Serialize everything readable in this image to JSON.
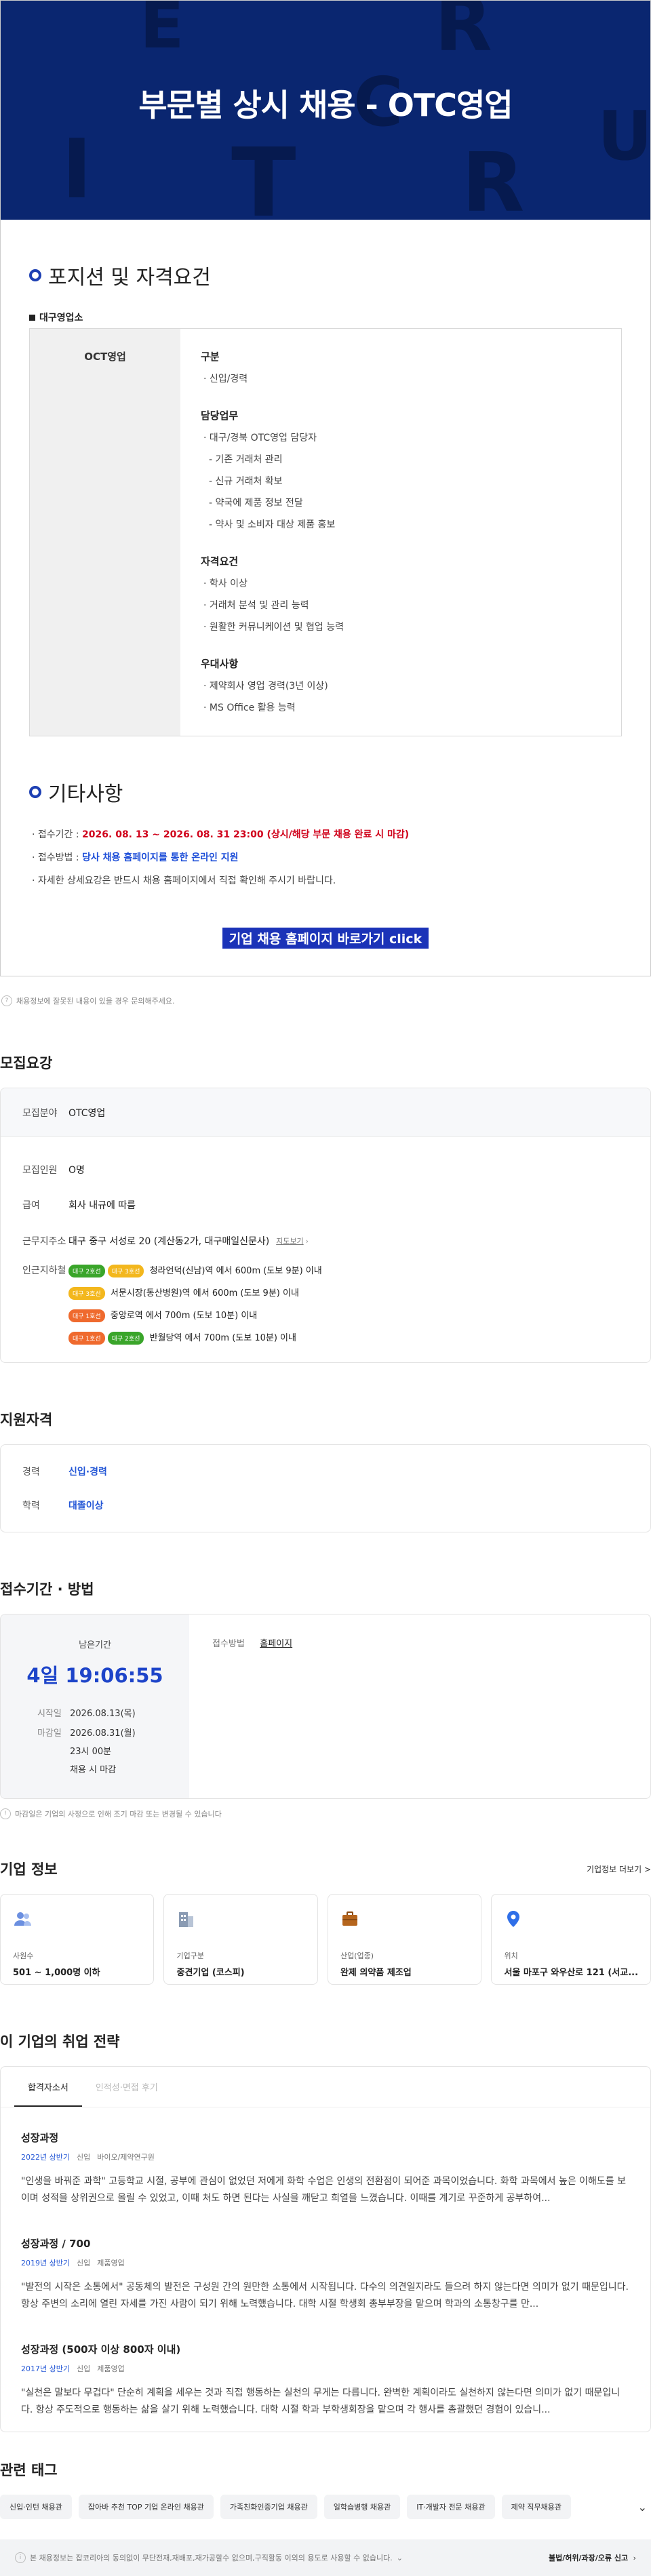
{
  "hero": {
    "title": "부문별 상시 채용 - OTC영업",
    "deco_letters": [
      "E",
      "R",
      "C",
      "U",
      "I",
      "T",
      "R"
    ]
  },
  "position": {
    "section_title": "포지션 및 자격요건",
    "dept_label": "대구영업소",
    "role": "OCT영업",
    "blocks": [
      {
        "head": "구분",
        "items": [
          "· 신입/경력"
        ]
      },
      {
        "head": "담당업무",
        "items": [
          "· 대구/경북 OTC영업 담당자",
          "- 기존 거래처 관리",
          "- 신규 거래처 확보",
          "- 약국에 제품 정보 전달",
          "- 약사 및 소비자 대상 제품 홍보"
        ]
      },
      {
        "head": "자격요건",
        "items": [
          "· 학사 이상",
          "· 거래처 분석 및 관리 능력",
          "· 원활한 커뮤니케이션 및 협업 능력"
        ]
      },
      {
        "head": "우대사항",
        "items": [
          "· 제약회사 영업 경력(3년 이상)",
          "· MS Office 활용 능력"
        ]
      }
    ]
  },
  "etc": {
    "section_title": "기타사항",
    "period_label": "· 접수기간 :",
    "period_value": "2026. 08. 13 ~ 2026. 08. 31 23:00 (상시/해당 부문 채용 완료 시 마감)",
    "method_label": "· 접수방법 :",
    "method_value": "당사 채용 홈페이지를 통한 온라인 지원",
    "detail": "· 자세한 상세요강은 반드시 채용 홈페이지에서 직접 확인해 주시기 바랍니다.",
    "apply_button": "기업 채용 홈페이지 바로가기 click"
  },
  "note1": "채용정보에 잘못된 내용이 있을 경우 문의해주세요.",
  "recruit": {
    "title": "모집요강",
    "field_label": "모집분야",
    "field_value": "OTC영업",
    "count_label": "모집인원",
    "count_value": "O명",
    "salary_label": "급여",
    "salary_value": "회사 내규에 따름",
    "address_label": "근무지주소",
    "address_value": "대구 중구 서성로 20 (계산동2가, 대구매일신문사)",
    "map_link": "지도보기",
    "station_label": "인근지하철",
    "stations": [
      {
        "badges": [
          {
            "t": "대구 2호선",
            "c": "green"
          },
          {
            "t": "대구 3호선",
            "c": "yellow"
          }
        ],
        "text": "청라언덕(신남)역 에서 600m (도보 9분) 이내"
      },
      {
        "badges": [
          {
            "t": "대구 3호선",
            "c": "yellow"
          }
        ],
        "text": "서문시장(동산병원)역 에서 600m (도보 9분) 이내"
      },
      {
        "badges": [
          {
            "t": "대구 1호선",
            "c": "orange"
          }
        ],
        "text": "중앙로역 에서 700m (도보 10분) 이내"
      },
      {
        "badges": [
          {
            "t": "대구 1호선",
            "c": "orange"
          },
          {
            "t": "대구 2호선",
            "c": "green"
          }
        ],
        "text": "반월당역 에서 700m (도보 10분) 이내"
      }
    ]
  },
  "qualification": {
    "title": "지원자격",
    "career_label": "경력",
    "career_value": "신입·경력",
    "edu_label": "학력",
    "edu_value": "대졸이상"
  },
  "deadline": {
    "title": "접수기간 · 방법",
    "remain_label": "남은기간",
    "remain_value": "4일 19:06:55",
    "start_label": "시작일",
    "start_value": "2026.08.13(목)",
    "end_label": "마감일",
    "end_value": "2026.08.31(월)",
    "end_time": "23시 00분",
    "end_note": "채용 시 마감",
    "method_label": "접수방법",
    "method_value": "홈페이지",
    "note": "마감일은 기업의 사정으로 인해 조기 마감 또는 변경될 수 있습니다"
  },
  "company": {
    "title": "기업 정보",
    "more": "기업정보 더보기 >",
    "cards": [
      {
        "label": "사원수",
        "value": "501 ~ 1,000명 이하",
        "icon": "people-icon",
        "color": "#6b8fe0"
      },
      {
        "label": "기업구분",
        "value": "중견기업 (코스피)",
        "icon": "building-icon",
        "color": "#8a9bb3"
      },
      {
        "label": "산업(업종)",
        "value": "완제 의약품 제조업",
        "icon": "briefcase-icon",
        "color": "#b5651d"
      },
      {
        "label": "위치",
        "value": "서울 마포구 와우산로 121 (서교...",
        "icon": "location-pin-icon",
        "color": "#2f6fe8"
      }
    ]
  },
  "strategy": {
    "title": "이 기업의 취업 전략",
    "tabs": [
      "합격자소서",
      "인적성·면접 후기"
    ],
    "stories": [
      {
        "title": "성장과정",
        "year": "2022년 상반기",
        "type": "신입",
        "job": "바이오/제약연구원",
        "text": "\"인생을 바꿔준 과학\" 고등학교 시절, 공부에 관심이 없었던 저에게 화학 수업은 인생의 전환점이 되어준 과목이었습니다. 화학 과목에서 높은 이해도를 보이며 성적을 상위권으로 올릴 수 있었고, 이때 처도 하면 된다는 사실을 깨닫고 희열을 느꼈습니다. 이때를 계기로 꾸준하게 공부하여..."
      },
      {
        "title": "성장과정 / 700",
        "year": "2019년 상반기",
        "type": "신입",
        "job": "제품영업",
        "text": "\"발전의 시작은 소통에서\" 공동체의 발전은 구성원 간의 원만한 소통에서 시작됩니다. 다수의 의견일지라도 들으려 하지 않는다면 의미가 없기 때문입니다. 항상 주변의 소리에 열린 자세를 가진 사람이 되기 위해 노력했습니다. 대학 시절 학생회 총부부장을 맡으며 학과의 소통창구를 만..."
      },
      {
        "title": "성장과정 (500자 이상 800자 이내)",
        "year": "2017년 상반기",
        "type": "신입",
        "job": "제품영업",
        "text": "\"실천은 말보다 무겁다\" 단순히 계획을 세우는 것과 직접 행동하는 실천의 무게는 다릅니다. 완벽한 계획이라도 실천하지 않는다면 의미가 없기 때문입니다. 항상 주도적으로 행동하는 삶을 살기 위해 노력했습니다. 대학 시절 학과 부학생회장을 맡으며 각 행사를 총괄했던 경험이 있습니..."
      }
    ]
  },
  "tags": {
    "title": "관련 태그",
    "items": [
      "신입·인턴 채용관",
      "잡아바 추천 TOP 기업 온라인 채용관",
      "가족친화인증기업 채용관",
      "일학습병행 채용관",
      "IT·개발자 전문 채용관",
      "제약 직무채용관"
    ]
  },
  "footer": {
    "notice": "본 채용정보는 잡코리아의 동의없이 무단전재,재배포,재가공할수 없으며,구직활동 이외의 용도로 사용할 수 없습니다.",
    "report": "불법/허위/과장/오류 신고"
  }
}
